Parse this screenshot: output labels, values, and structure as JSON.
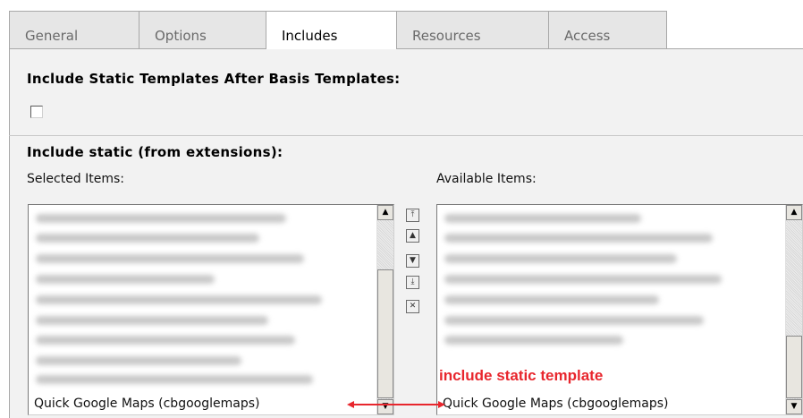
{
  "tabs": [
    {
      "label": "General",
      "active": false
    },
    {
      "label": "Options",
      "active": false
    },
    {
      "label": "Includes",
      "active": true
    },
    {
      "label": "Resources",
      "active": false
    },
    {
      "label": "Access",
      "active": false
    }
  ],
  "include_static_after_basis": {
    "label": "Include Static Templates After Basis Templates:",
    "checked": false
  },
  "include_static_extensions": {
    "label": "Include static (from extensions):",
    "selected_label": "Selected Items:",
    "available_label": "Available Items:",
    "selected_visible_item": "Quick Google Maps (cbgooglemaps)",
    "available_visible_item": "Quick Google Maps (cbgooglemaps)"
  },
  "annotation": {
    "text": "include static template",
    "color": "#e8262d"
  },
  "icons": {
    "move_top": "move-to-top-icon",
    "move_up": "move-up-icon",
    "move_down": "move-down-icon",
    "move_bottom": "move-to-bottom-icon",
    "remove": "remove-icon"
  }
}
